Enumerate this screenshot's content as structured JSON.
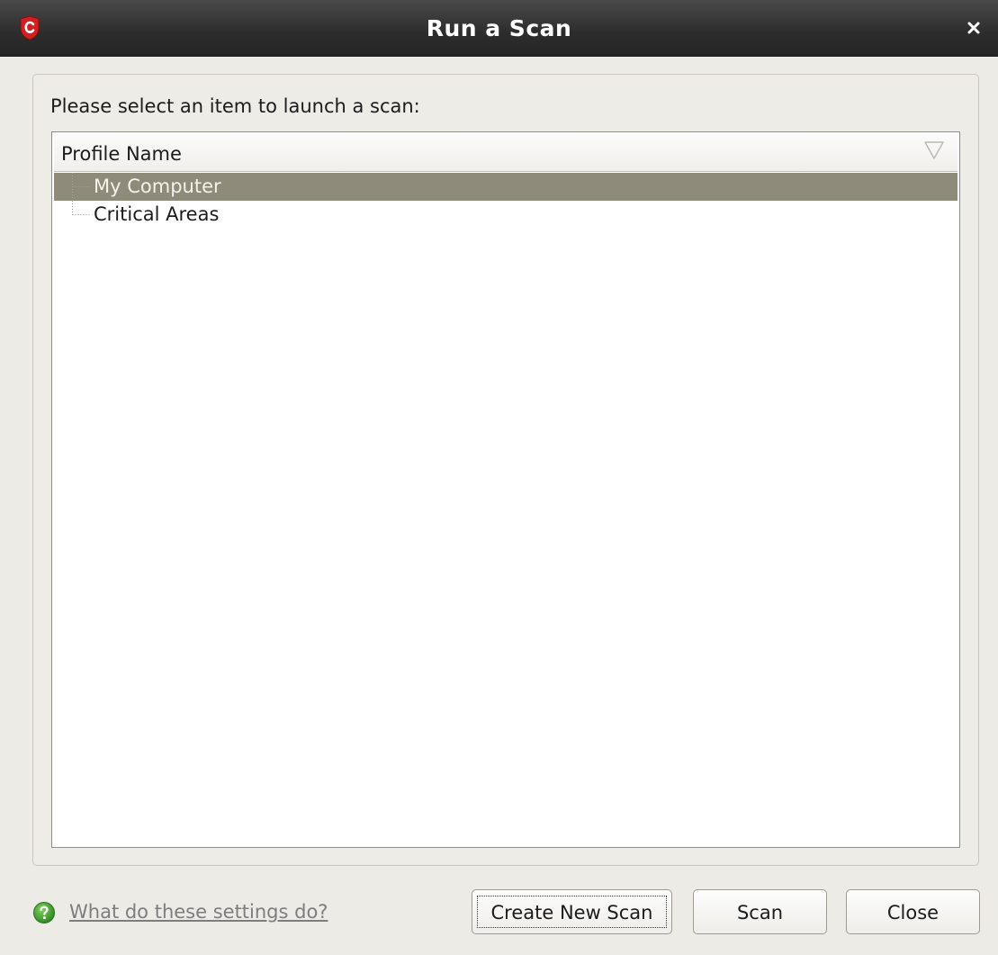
{
  "window": {
    "title": "Run a Scan",
    "app_icon": "comodo-c-shield-icon",
    "close_icon": "close-icon"
  },
  "prompt": "Please select an item to launch a scan:",
  "tree": {
    "column_header": "Profile Name",
    "sort_icon": "sort-triangle-icon",
    "rows": [
      {
        "label": "My Computer",
        "selected": true
      },
      {
        "label": "Critical Areas",
        "selected": false
      }
    ]
  },
  "footer": {
    "help_icon": "help-icon",
    "help_link": "What do these settings do?",
    "buttons": {
      "create_new_scan": "Create New Scan",
      "scan": "Scan",
      "close": "Close"
    }
  },
  "colors": {
    "selection": "#8e8b7a",
    "titlebar": "#2c2c2c",
    "dialog_background": "#ecebe6",
    "help_icon_green": "#3ea12f",
    "app_icon_red": "#d21f1f"
  }
}
